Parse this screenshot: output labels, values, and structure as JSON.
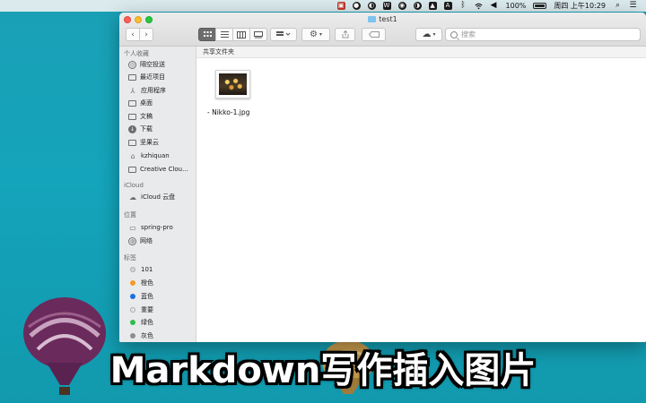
{
  "menubar": {
    "battery_text": "100%",
    "clock": "周四 上午10:29",
    "icons": [
      "app-icon-1",
      "app-icon-2",
      "app-icon-3",
      "word-icon",
      "app-icon-5",
      "app-icon-6",
      "app-icon-7",
      "text-icon",
      "bluetooth-icon",
      "wifi-icon",
      "volume-icon",
      "battery-icon",
      "search-icon",
      "control-center-icon"
    ],
    "icon_glyphs": {
      "word": "W",
      "text": "A"
    }
  },
  "window": {
    "title": "test1",
    "search_placeholder": "搜索",
    "breadcrumb": "共享文件夹"
  },
  "sidebar": {
    "favorites_header": "个人收藏",
    "favorites": [
      "隔空投送",
      "最近项目",
      "应用程序",
      "桌面",
      "文稿",
      "下载",
      "坚果云",
      "kzhiquan",
      "Creative Clou..."
    ],
    "icloud_header": "iCloud",
    "icloud": [
      "iCloud 云盘"
    ],
    "locations_header": "位置",
    "locations": [
      "spring-pro",
      "网络"
    ],
    "tags_header": "标签",
    "tags": [
      {
        "label": "101",
        "color": "#c9c9c9"
      },
      {
        "label": "橙色",
        "color": "#f39a2b"
      },
      {
        "label": "蓝色",
        "color": "#1b6fe0"
      },
      {
        "label": "重要",
        "color": "#d7d7d7"
      },
      {
        "label": "绿色",
        "color": "#2fbd4a"
      },
      {
        "label": "灰色",
        "color": "#8e8e8e"
      }
    ]
  },
  "files": [
    {
      "name": "- Nikko-1.jpg"
    }
  ],
  "caption": "Markdown写作插入图片",
  "colors": {
    "desktop": "#14a4bb",
    "balloon_purple": "#6b2a5c",
    "balloon_gold": "#c69a4c"
  }
}
